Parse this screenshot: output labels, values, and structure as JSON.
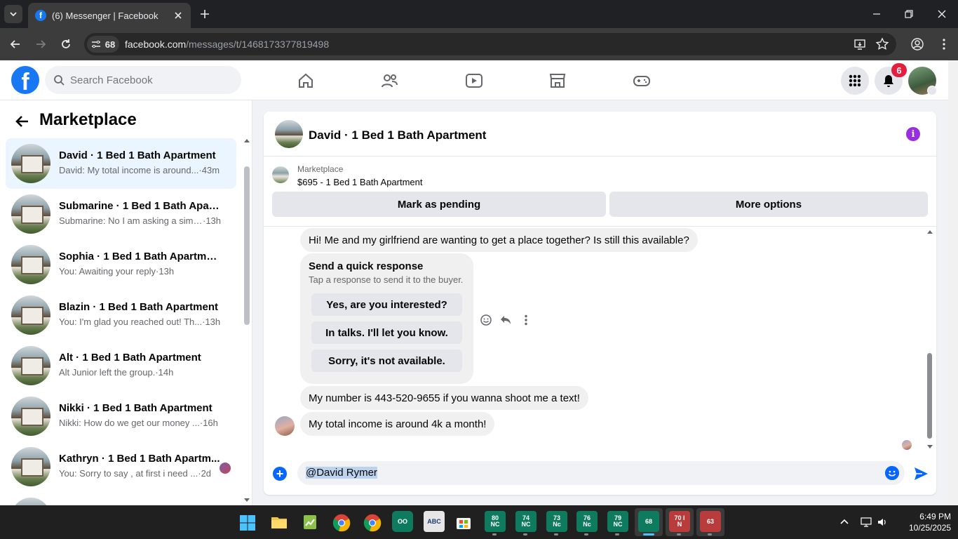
{
  "browser": {
    "tab_title": "(6) Messenger | Facebook",
    "site_info_count": "68",
    "url_host": "facebook.com",
    "url_path": "/messages/t/1468173377819498"
  },
  "fb": {
    "search_placeholder": "Search Facebook",
    "notification_count": "6",
    "brand_color": "#1877f2"
  },
  "sidebar": {
    "title": "Marketplace",
    "conversations": [
      {
        "name": "David · 1 Bed 1 Bath Apartment",
        "preview": "David: My total income is around...",
        "time": "·43m",
        "active": true
      },
      {
        "name": "Submarine · 1 Bed 1 Bath Apart...",
        "preview": "Submarine: No I am asking a simp...",
        "time": "·13h"
      },
      {
        "name": "Sophia · 1 Bed 1 Bath Apartment",
        "preview": "You: Awaiting your reply",
        "time": "·13h"
      },
      {
        "name": "Blazin · 1 Bed 1 Bath Apartment",
        "preview": "You: I'm glad you reached out! Th...",
        "time": "·13h"
      },
      {
        "name": "Alt · 1 Bed 1 Bath Apartment",
        "preview": "Alt Junior left the group.",
        "time": "·14h"
      },
      {
        "name": "Nikki · 1 Bed 1 Bath Apartment",
        "preview": "Nikki: How do we get our money ...",
        "time": "·16h"
      },
      {
        "name": "Kathryn · 1 Bed 1 Bath Apartm...",
        "preview": "You: Sorry to say , at first i need ...",
        "time": "·2d"
      }
    ]
  },
  "chat": {
    "title": "David · 1 Bed 1 Bath Apartment",
    "listing_category": "Marketplace",
    "listing_desc": "$695 - 1 Bed 1 Bath Apartment",
    "mark_pending": "Mark as pending",
    "more_options": "More options",
    "messages": [
      "Hi! Me and my girlfriend are wanting to get a place together? Is still this available?",
      "My number is 443-520-9655 if you wanna shoot me a text!",
      "My total income is around 4k a month!"
    ],
    "quick_response": {
      "title": "Send a quick response",
      "subtitle": "Tap a response to send it to the buyer.",
      "options": [
        "Yes, are you interested?",
        "In talks. I'll let you know.",
        "Sorry, it's not available."
      ]
    },
    "composer_text": "@David Rymer",
    "accent": "#0866ff"
  },
  "taskbar": {
    "apps": [
      "80\nNC",
      "74\nNC",
      "73\nNc",
      "76\nNc",
      "79\nNC",
      "68",
      "70 I\nN",
      "63"
    ],
    "time": "6:49 PM",
    "date": "10/25/2025"
  }
}
